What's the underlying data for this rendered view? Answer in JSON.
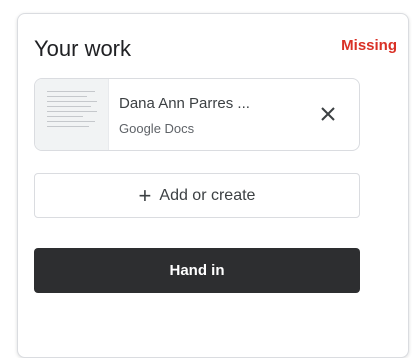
{
  "work_card": {
    "title": "Your work",
    "status": "Missing",
    "attachment": {
      "name": "Dana Ann Parres ...",
      "type": "Google Docs",
      "thumbnail_icon": "document-thumbnail-icon",
      "remove_icon": "close-icon"
    },
    "add_button_label": "Add or create",
    "add_button_icon": "plus-icon",
    "hand_in_label": "Hand in"
  },
  "colors": {
    "status": "#d93025",
    "hand_in_bg": "#2d2e30",
    "border": "#dadce0"
  }
}
